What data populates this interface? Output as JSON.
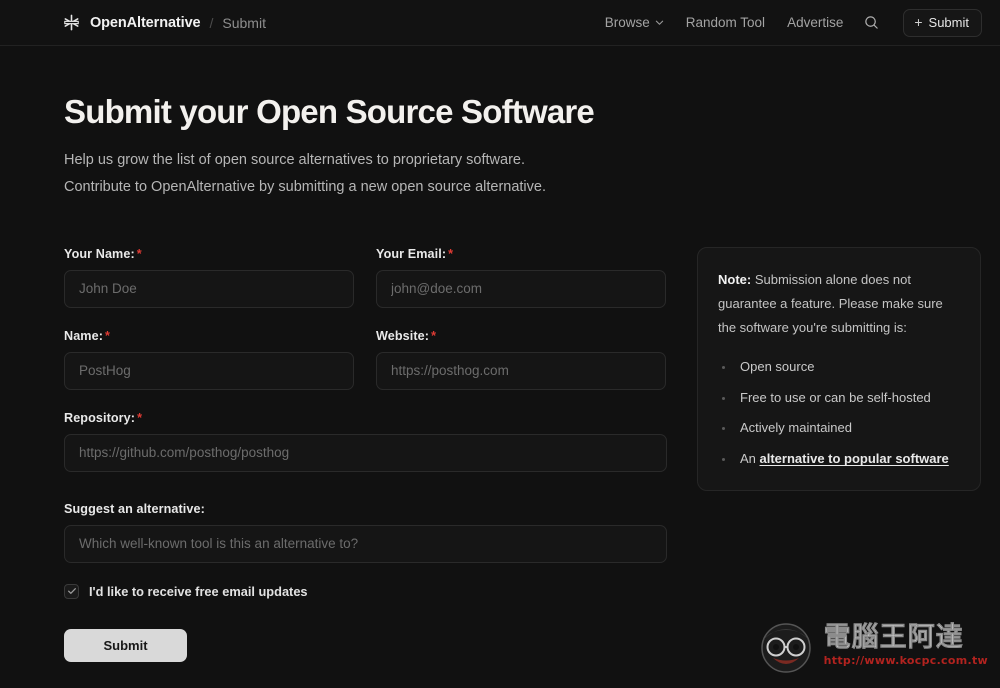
{
  "header": {
    "logo_icon": "asterisk-star-icon",
    "brand": "OpenAlternative",
    "separator": "/",
    "breadcrumb_current": "Submit",
    "nav": [
      {
        "label": "Browse",
        "has_chevron": true
      },
      {
        "label": "Random Tool",
        "has_chevron": false
      },
      {
        "label": "Advertise",
        "has_chevron": false
      }
    ],
    "search_icon": "search-icon",
    "submit_button": {
      "plus": "+",
      "label": "Submit"
    }
  },
  "hero": {
    "title": "Submit your Open Source Software",
    "subtitle_line1": "Help us grow the list of open source alternatives to proprietary software.",
    "subtitle_line2": "Contribute to OpenAlternative by submitting a new open source alternative."
  },
  "form": {
    "required_marker": "*",
    "fields": {
      "your_name": {
        "label": "Your Name:",
        "placeholder": "John Doe",
        "value": "",
        "required": true
      },
      "your_email": {
        "label": "Your Email:",
        "placeholder": "john@doe.com",
        "value": "",
        "required": true
      },
      "name": {
        "label": "Name:",
        "placeholder": "PostHog",
        "value": "",
        "required": true
      },
      "website": {
        "label": "Website:",
        "placeholder": "https://posthog.com",
        "value": "",
        "required": true
      },
      "repository": {
        "label": "Repository:",
        "placeholder": "https://github.com/posthog/posthog",
        "value": "",
        "required": true
      },
      "suggest": {
        "label": "Suggest an alternative:",
        "placeholder": "Which well-known tool is this an alternative to?",
        "value": "",
        "required": false
      }
    },
    "newsletter": {
      "label": "I'd like to receive free email updates",
      "checked": true
    },
    "submit_label": "Submit"
  },
  "note": {
    "prefix": "Note:",
    "body": " Submission alone does not guarantee a feature. Please make sure the software you're submitting is:",
    "items": [
      {
        "text": "Open source",
        "link": ""
      },
      {
        "text": "Free to use or can be self-hosted",
        "link": ""
      },
      {
        "text": "Actively maintained",
        "link": ""
      },
      {
        "text": "An ",
        "link": "alternative to popular software"
      }
    ]
  },
  "watermark": {
    "title": "電腦王阿達",
    "url": "http://www.kocpc.com.tw"
  },
  "colors": {
    "background": "#111111",
    "panel": "#161616",
    "border": "#2a2a2a",
    "required": "#e03b34",
    "submit_bg": "#d9d9d9",
    "watermark_url": "#b2231f"
  }
}
